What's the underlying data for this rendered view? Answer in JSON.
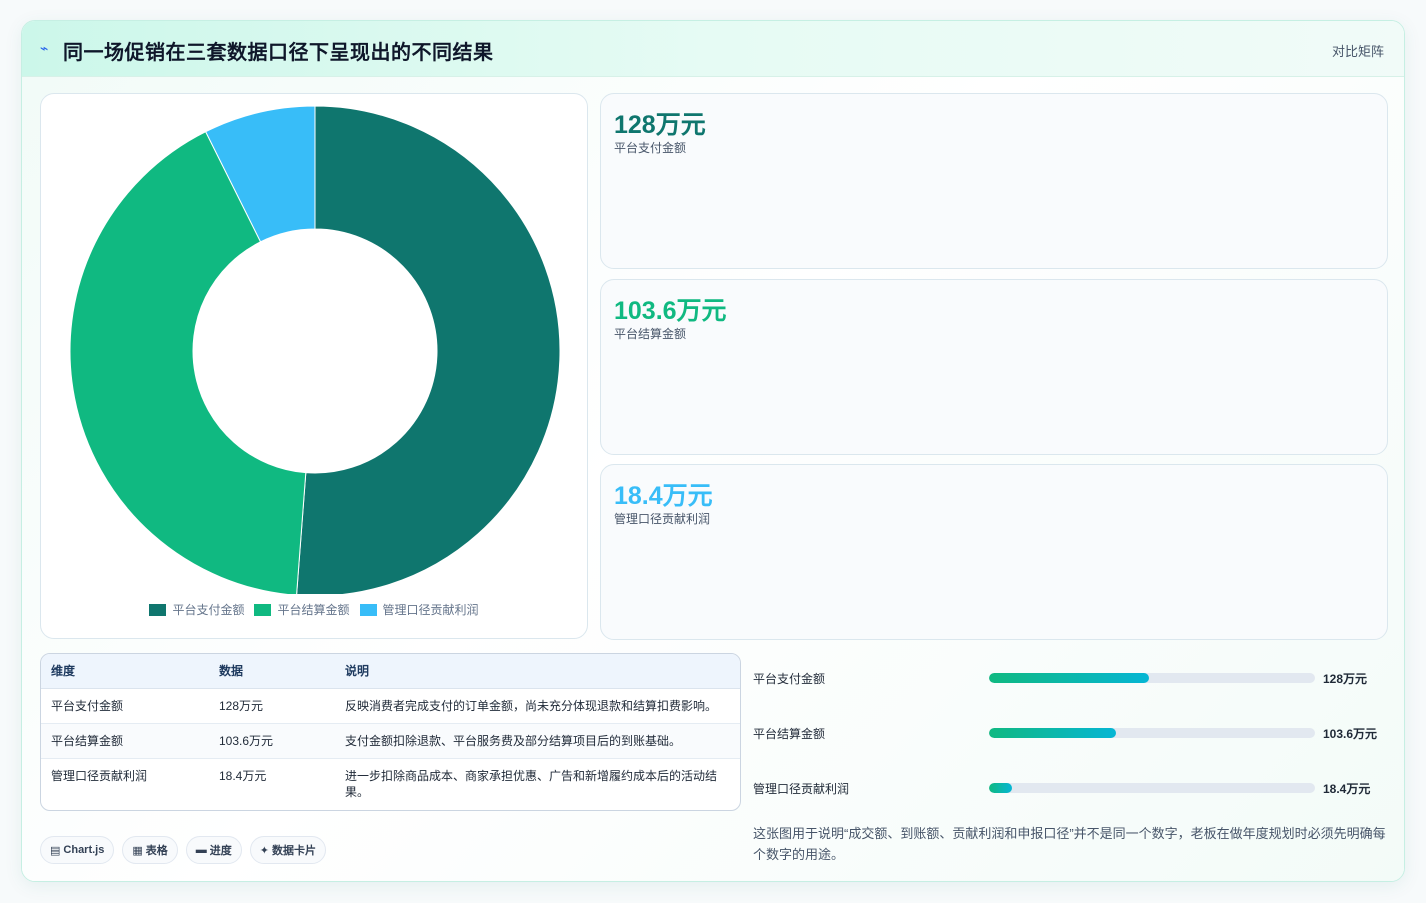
{
  "header": {
    "spark_icon": "sparkline-icon",
    "title": "同一场促销在三套数据口径下呈现出的不同结果",
    "right_label": "对比矩阵"
  },
  "colors": {
    "dark_teal": "#0f766e",
    "green": "#10b981",
    "sky": "#38bdf8"
  },
  "chart_data": {
    "type": "doughnut",
    "series": [
      {
        "name": "平台支付金额",
        "value": 128,
        "color": "#0f766e"
      },
      {
        "name": "平台结算金额",
        "value": 103.6,
        "color": "#10b981"
      },
      {
        "name": "管理口径贡献利润",
        "value": 18.4,
        "color": "#38bdf8"
      }
    ],
    "legend_position": "bottom"
  },
  "stats": [
    {
      "value": "128万元",
      "label": "平台支付金额",
      "color": "#0f766e"
    },
    {
      "value": "103.6万元",
      "label": "平台结算金额",
      "color": "#10b981"
    },
    {
      "value": "18.4万元",
      "label": "管理口径贡献利润",
      "color": "#38bdf8"
    }
  ],
  "table": {
    "headers": [
      "维度",
      "数据",
      "说明"
    ],
    "rows": [
      [
        "平台支付金额",
        "128万元",
        "反映消费者完成支付的订单金额，尚未充分体现退款和结算扣费影响。"
      ],
      [
        "平台结算金额",
        "103.6万元",
        "支付金额扣除退款、平台服务费及部分结算项目后的到账基础。"
      ],
      [
        "管理口径贡献利润",
        "18.4万元",
        "进一步扣除商品成本、商家承担优惠、广告和新增履约成本后的活动结果。"
      ]
    ]
  },
  "chips": [
    {
      "icon": "▤",
      "label": "Chart.js"
    },
    {
      "icon": "▦",
      "label": "表格"
    },
    {
      "icon": "▬",
      "label": "进度"
    },
    {
      "icon": "✦",
      "label": "数据卡片"
    }
  ],
  "progress": [
    {
      "label": "平台支付金额",
      "value": "128万元",
      "fraction": 0.49
    },
    {
      "label": "平台结算金额",
      "value": "103.6万元",
      "fraction": 0.39
    },
    {
      "label": "管理口径贡献利润",
      "value": "18.4万元",
      "fraction": 0.07
    }
  ],
  "note": "这张图用于说明“成交额、到账额、贡献利润和申报口径”并不是同一个数字，老板在做年度规划时必须先明确每个数字的用途。"
}
